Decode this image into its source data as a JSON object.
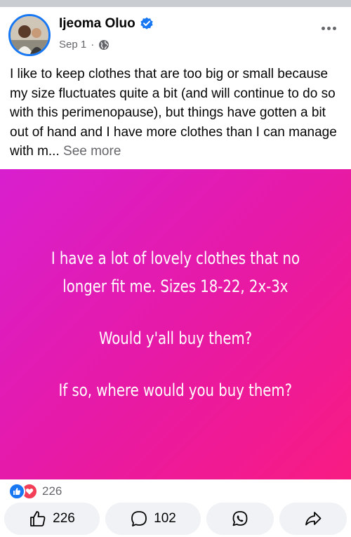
{
  "post": {
    "author": "Ijeoma Oluo",
    "date": "Sep 1",
    "separator": "·",
    "verified_icon": "verified-badge-icon",
    "privacy_icon": "globe-icon",
    "caption": "I like to keep clothes that are too big or small because my size fluctuates quite a bit (and will continue to do so with this perimenopause), but things have gotten a bit out of hand and I have more clothes than I can manage with m...",
    "see_more": "See more"
  },
  "status_post": {
    "line1": "I have a lot of lovely clothes that no",
    "line2": "longer fit me. Sizes 18-22, 2x-3x",
    "line3": "Would y'all buy them?",
    "line4": "If so, where would you buy them?",
    "background_colors": [
      "#d81fcf",
      "#f81b82"
    ]
  },
  "reactions": {
    "count": "226",
    "icons": [
      "like-icon",
      "love-icon"
    ]
  },
  "actions": {
    "like_count": "226",
    "comment_count": "102"
  },
  "colors": {
    "accent": "#1877f2",
    "love": "#f33e58",
    "muted": "#65676b"
  }
}
